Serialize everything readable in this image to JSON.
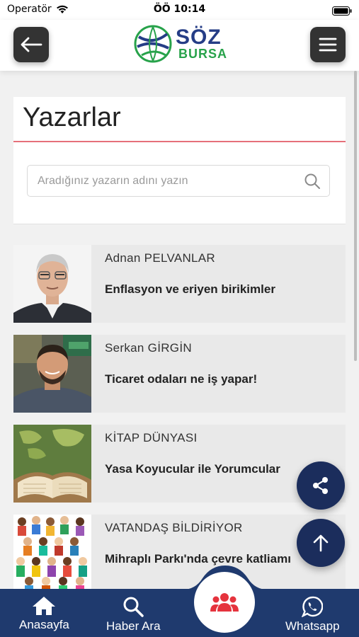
{
  "status_bar": {
    "carrier": "Operatör",
    "time": "ÖÖ 10:14"
  },
  "header": {
    "logo_top": "SÖZ",
    "logo_bottom": "BURSA"
  },
  "page": {
    "title": "Yazarlar",
    "search_placeholder": "Aradığınız yazarın adını yazın"
  },
  "authors": [
    {
      "name": "Adnan PELVANLAR",
      "headline": "Enflasyon ve eriyen birikimler"
    },
    {
      "name": "Serkan GİRGİN",
      "headline": "Ticaret odaları ne iş yapar!"
    },
    {
      "name": "KİTAP DÜNYASI",
      "headline": "Yasa Koyucular ile Yorumcular"
    },
    {
      "name": "VATANDAŞ BİLDİRİYOR",
      "headline": "Mihraplı Parkı'nda çevre katliamı"
    }
  ],
  "bottom_nav": {
    "home_label": "Anasayfa",
    "search_label": "Haber Ara",
    "whatsapp_label": "Whatsapp"
  },
  "colors": {
    "brand_navy": "#1f3a6e",
    "logo_green": "#27a24a",
    "accent_red": "#e5333d"
  },
  "icons": {
    "back": "arrow-left-icon",
    "menu": "hamburger-icon",
    "search": "search-icon",
    "share": "share-icon",
    "up": "arrow-up-icon",
    "home": "home-icon",
    "users": "users-icon",
    "whatsapp": "whatsapp-icon"
  }
}
